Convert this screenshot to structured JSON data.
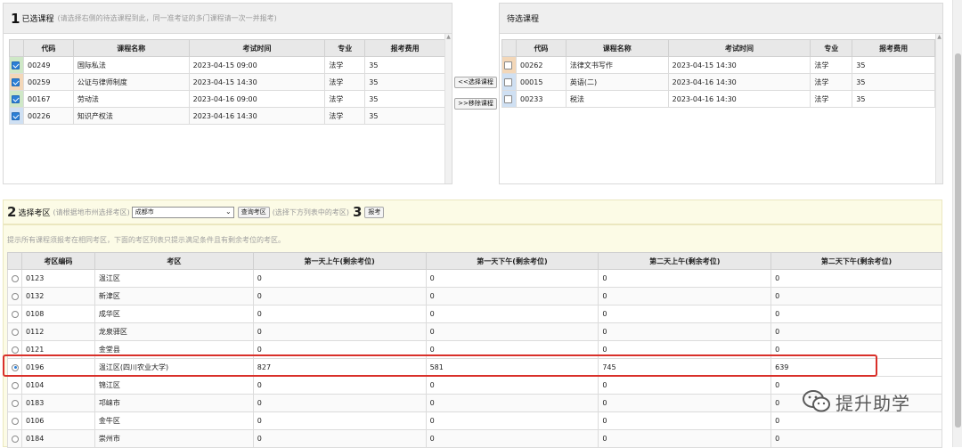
{
  "selected": {
    "num": "1",
    "title": "已选课程",
    "hint": "(请选择右侧的待选课程到此，同一准考证的多门课程请一次一并报考)",
    "columns": [
      "代码",
      "课程名称",
      "考试时间",
      "专业",
      "报考费用"
    ],
    "rows": [
      {
        "code": "00249",
        "name": "国际私法",
        "time": "2023-04-15 09:00",
        "major": "法学",
        "fee": "35"
      },
      {
        "code": "00259",
        "name": "公证与律师制度",
        "time": "2023-04-15 14:30",
        "major": "法学",
        "fee": "35"
      },
      {
        "code": "00167",
        "name": "劳动法",
        "time": "2023-04-16 09:00",
        "major": "法学",
        "fee": "35"
      },
      {
        "code": "00226",
        "name": "知识产权法",
        "time": "2023-04-16 14:30",
        "major": "法学",
        "fee": "35"
      }
    ]
  },
  "pending": {
    "title": "待选课程",
    "columns": [
      "代码",
      "课程名称",
      "考试时间",
      "专业",
      "报考费用"
    ],
    "rows": [
      {
        "code": "00262",
        "name": "法律文书写作",
        "time": "2023-04-15 14:30",
        "major": "法学",
        "fee": "35"
      },
      {
        "code": "00015",
        "name": "英语(二)",
        "time": "2023-04-16 14:30",
        "major": "法学",
        "fee": "35"
      },
      {
        "code": "00233",
        "name": "税法",
        "time": "2023-04-16 14:30",
        "major": "法学",
        "fee": "35"
      }
    ]
  },
  "buttons": {
    "select_course": "<<选择课程",
    "remove_course": ">>移除课程"
  },
  "step2": {
    "num": "2",
    "title": "选择考区",
    "hint": "(请根据地市州选择考区)",
    "city": "成都市",
    "query_button": "查询考区",
    "hint2": "(选择下方列表中的考区)",
    "num3": "3",
    "apply_button": "报考"
  },
  "notice": "提示所有课程须报考在相同考区，下面的考区列表只提示满足条件且有剩余考位的考区。",
  "exam_areas": {
    "columns": [
      "考区编码",
      "考区",
      "第一天上午(剩余考位)",
      "第一天下午(剩余考位)",
      "第二天上午(剩余考位)",
      "第二天下午(剩余考位)"
    ],
    "rows": [
      {
        "code": "0123",
        "name": "温江区",
        "d1am": "0",
        "d1pm": "0",
        "d2am": "0",
        "d2pm": "0"
      },
      {
        "code": "0132",
        "name": "新津区",
        "d1am": "0",
        "d1pm": "0",
        "d2am": "0",
        "d2pm": "0"
      },
      {
        "code": "0108",
        "name": "成华区",
        "d1am": "0",
        "d1pm": "0",
        "d2am": "0",
        "d2pm": "0"
      },
      {
        "code": "0112",
        "name": "龙泉驿区",
        "d1am": "0",
        "d1pm": "0",
        "d2am": "0",
        "d2pm": "0"
      },
      {
        "code": "0121",
        "name": "金堂县",
        "d1am": "0",
        "d1pm": "0",
        "d2am": "0",
        "d2pm": "0"
      },
      {
        "code": "0196",
        "name": "温江区(四川农业大学)",
        "d1am": "827",
        "d1pm": "581",
        "d2am": "745",
        "d2pm": "639"
      },
      {
        "code": "0104",
        "name": "锦江区",
        "d1am": "0",
        "d1pm": "0",
        "d2am": "0",
        "d2pm": "0"
      },
      {
        "code": "0183",
        "name": "邛崃市",
        "d1am": "0",
        "d1pm": "0",
        "d2am": "0",
        "d2pm": "0"
      },
      {
        "code": "0106",
        "name": "金牛区",
        "d1am": "0",
        "d1pm": "0",
        "d2am": "0",
        "d2pm": "0"
      },
      {
        "code": "0184",
        "name": "崇州市",
        "d1am": "0",
        "d1pm": "0",
        "d2am": "0",
        "d2pm": "0"
      }
    ]
  },
  "watermark": "提升助学",
  "colors": {
    "highlight": "#d9302a",
    "accent": "#2b7fd6",
    "notice_bg": "#fcfbe6"
  }
}
